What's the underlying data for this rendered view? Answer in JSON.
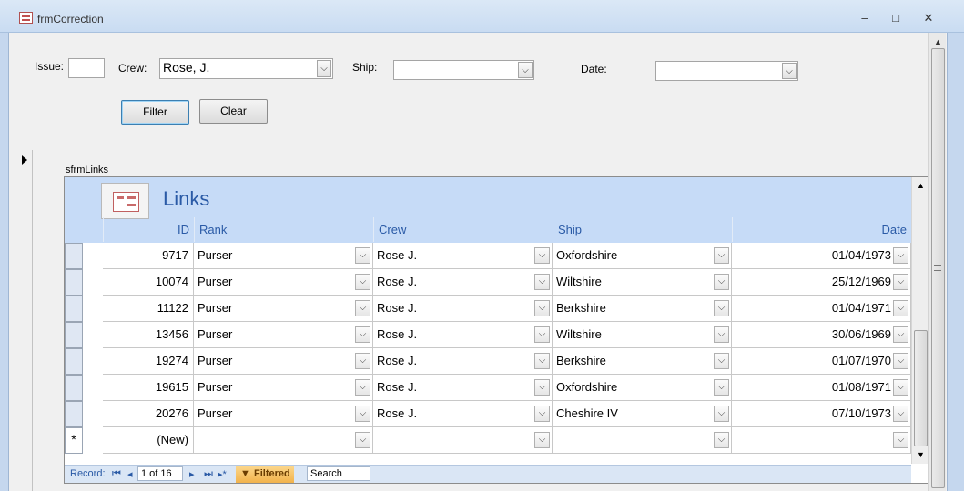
{
  "window": {
    "title": "frmCorrection",
    "minimize_glyph": "–",
    "maximize_glyph": "□",
    "close_glyph": "✕"
  },
  "filters": {
    "issue_label": "Issue:",
    "issue_value": "",
    "crew_label": "Crew:",
    "crew_value": "Rose, J.",
    "ship_label": "Ship:",
    "ship_value": "",
    "date_label": "Date:",
    "date_value": "",
    "filter_button": "Filter",
    "clear_button": "Clear"
  },
  "subform": {
    "name": "sfrmLinks",
    "title": "Links",
    "columns": [
      "ID",
      "Rank",
      "Crew",
      "Ship",
      "Date"
    ],
    "rows": [
      {
        "id": "9717",
        "rank": "Purser",
        "crew": "Rose J.",
        "ship": "Oxfordshire",
        "date": "01/04/1973"
      },
      {
        "id": "10074",
        "rank": "Purser",
        "crew": "Rose J.",
        "ship": "Wiltshire",
        "date": "25/12/1969"
      },
      {
        "id": "11122",
        "rank": "Purser",
        "crew": "Rose J.",
        "ship": "Berkshire",
        "date": "01/04/1971"
      },
      {
        "id": "13456",
        "rank": "Purser",
        "crew": "Rose J.",
        "ship": "Wiltshire",
        "date": "30/06/1969"
      },
      {
        "id": "19274",
        "rank": "Purser",
        "crew": "Rose J.",
        "ship": "Berkshire",
        "date": "01/07/1970"
      },
      {
        "id": "19615",
        "rank": "Purser",
        "crew": "Rose J.",
        "ship": "Oxfordshire",
        "date": "01/08/1971"
      },
      {
        "id": "20276",
        "rank": "Purser",
        "crew": "Rose J.",
        "ship": "Cheshire IV",
        "date": "07/10/1973"
      }
    ],
    "new_row_marker": "*",
    "new_row_id": "(New)"
  },
  "navigation": {
    "record_label": "Record:",
    "first_glyph": "⏮",
    "prev_glyph": "◂",
    "position": "1 of 16",
    "next_glyph": "▸",
    "last_glyph": "⏭",
    "new_glyph": "▸*",
    "filter_status": "Filtered",
    "search_placeholder": "Search"
  }
}
